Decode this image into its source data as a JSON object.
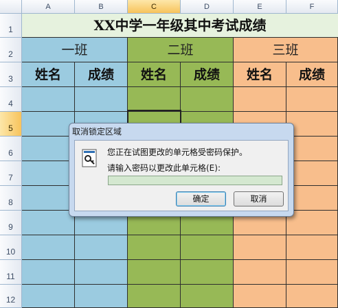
{
  "columns": [
    "A",
    "B",
    "C",
    "D",
    "E",
    "F"
  ],
  "rows": [
    "1",
    "2",
    "3",
    "4",
    "5",
    "6",
    "7",
    "8",
    "9",
    "10",
    "11",
    "12"
  ],
  "sheet": {
    "title": "XX中学一年级其中考试成绩",
    "classes": [
      "一班",
      "二班",
      "三班"
    ],
    "subheaders": [
      "姓名",
      "成绩",
      "姓名",
      "成绩",
      "姓名",
      "成绩"
    ]
  },
  "colors": {
    "class1": "#9bcbe0",
    "class2": "#97b956",
    "class3": "#f8be8c",
    "title_bg": "#e6f2de"
  },
  "dialog": {
    "title": "取消锁定区域",
    "message": "您正在试图更改的单元格受密码保护。",
    "prompt": "请输入密码以更改此单元格(E):",
    "password_value": "",
    "ok_label": "确定",
    "cancel_label": "取消",
    "icon": "key-lock-icon"
  }
}
